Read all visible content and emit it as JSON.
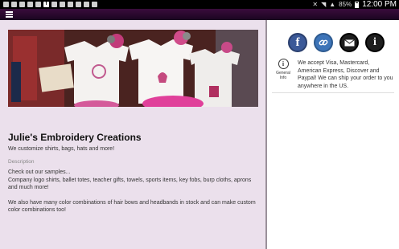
{
  "statusbar": {
    "time": "12:00 PM",
    "battery": "85%"
  },
  "business": {
    "name": "Julie's Embroidery Creations",
    "tagline": "We customize shirts, bags, hats and more!",
    "description_label": "Description",
    "description_lines": [
      "Check out our samples...",
      "Company logo shirts, ballet totes, teacher gifts, towels, sports items, key fobs, burp cloths, aprons and much more!",
      "We also have many color combinations of hair bows and headbands in stock and can make custom color combinations too!"
    ]
  },
  "sidebar": {
    "icons": [
      "facebook-icon",
      "link-icon",
      "mail-icon",
      "info-icon"
    ],
    "general_info_label": "General Info",
    "general_info_text": "We accept Visa, Mastercard, American Express, Discover and Paypal! We can ship your order to you anywhere in the US."
  },
  "colors": {
    "appbar": "#2a0a2e",
    "content_bg": "#ebe0ec",
    "facebook": "#3b5998"
  }
}
